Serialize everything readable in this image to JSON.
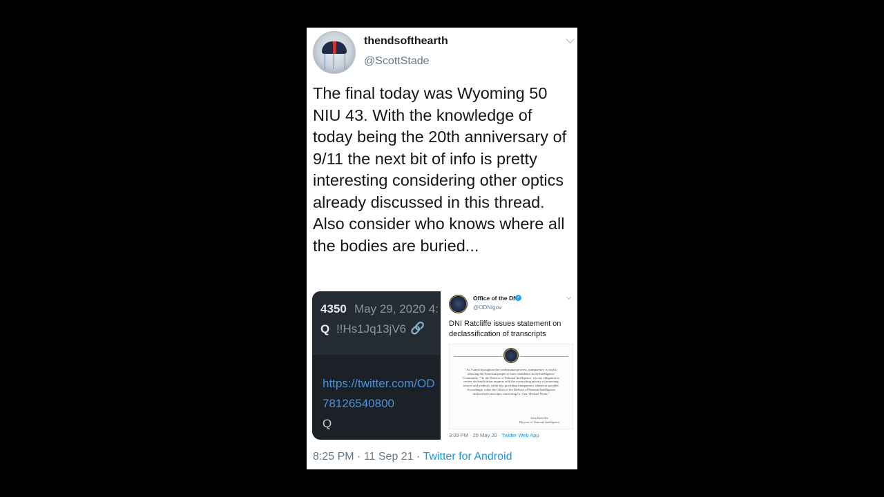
{
  "author": {
    "display_name": "thendsofthearth",
    "handle": "@ScottStade"
  },
  "tweet": {
    "text": "The final today was Wyoming 50 NIU 43. With the knowledge of today being the 20th anniversary of 9/11 the next bit of info is pretty interesting considering other optics already discussed in this thread. Also consider who knows where all the bodies are buried...",
    "time": "8:25 PM",
    "separator": "·",
    "date": "11 Sep 21",
    "source": "Twitter for Android"
  },
  "media_left": {
    "post_number": "4350",
    "post_date": "May 29, 2020 4:",
    "poster_name": "Q",
    "tripcode": "!!Hs1Jq13jV6",
    "link_icon": "link-icon",
    "url_line1": "https://twitter.com/OD",
    "url_line2": "78126540800",
    "signature": "Q"
  },
  "media_right": {
    "account_name": "Office of the DNI",
    "account_handle": "@ODNIgov",
    "verified_icon": "verified-badge-icon",
    "text": "DNI Ratcliffe issues statement on declassification of transcripts",
    "document_text": "\"As I stated throughout the confirmation process, transparency is vital to allowing the American people to have confidence in the Intelligence Community. \"As the Director of National Intelligence, it is my obligation to review declassification requests with the overarching priority of protecting sources and methods, while also providing transparency whenever possible. Accordingly, today the Office of the Director of National Intelligence declassified transcripts concerning Lt. Gen. Michael Flynn.\"",
    "document_signature": "John Ratcliffe",
    "document_signature_title": "Director of National Intelligence",
    "meta_time": "3:09 PM · 29 May 20 · ",
    "meta_app": "Twitter Web App"
  },
  "colors": {
    "background": "#000000",
    "card": "#ffffff",
    "link": "#1b95e0",
    "muted": "#657786",
    "dark_panel": "#1c2128"
  }
}
